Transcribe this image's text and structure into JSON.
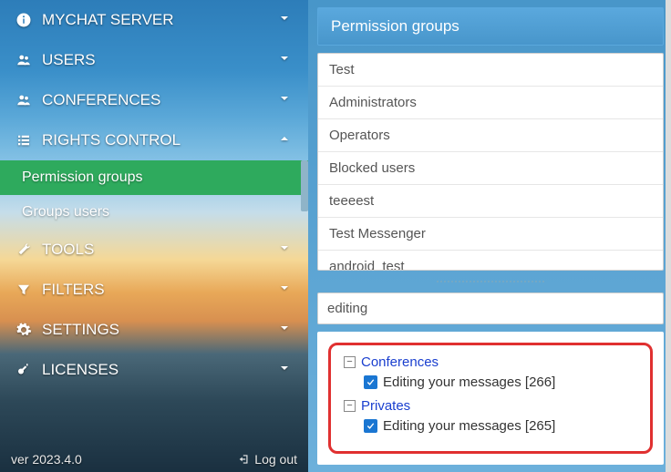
{
  "sidebar": {
    "items": [
      {
        "label": "MYCHAT SERVER",
        "icon": "info"
      },
      {
        "label": "USERS",
        "icon": "users"
      },
      {
        "label": "CONFERENCES",
        "icon": "users"
      },
      {
        "label": "RIGHTS CONTROL",
        "icon": "list",
        "expanded": true,
        "children": [
          {
            "label": "Permission groups",
            "active": true
          },
          {
            "label": "Groups users",
            "active": false
          }
        ]
      },
      {
        "label": "TOOLS",
        "icon": "wrench"
      },
      {
        "label": "FILTERS",
        "icon": "filter"
      },
      {
        "label": "SETTINGS",
        "icon": "gear"
      },
      {
        "label": "LICENSES",
        "icon": "key"
      }
    ],
    "footer": {
      "version": "ver 2023.4.0",
      "logout": "Log out"
    }
  },
  "main": {
    "header": "Permission groups",
    "groups": [
      "Test",
      "Administrators",
      "Operators",
      "Blocked users",
      "teeeest",
      "Test Messenger",
      "android_test"
    ],
    "search": "editing",
    "tree": [
      {
        "group": "Conferences",
        "items": [
          {
            "label": "Editing your messages [266]",
            "checked": true
          }
        ]
      },
      {
        "group": "Privates",
        "items": [
          {
            "label": "Editing your messages [265]",
            "checked": true
          }
        ]
      }
    ]
  }
}
